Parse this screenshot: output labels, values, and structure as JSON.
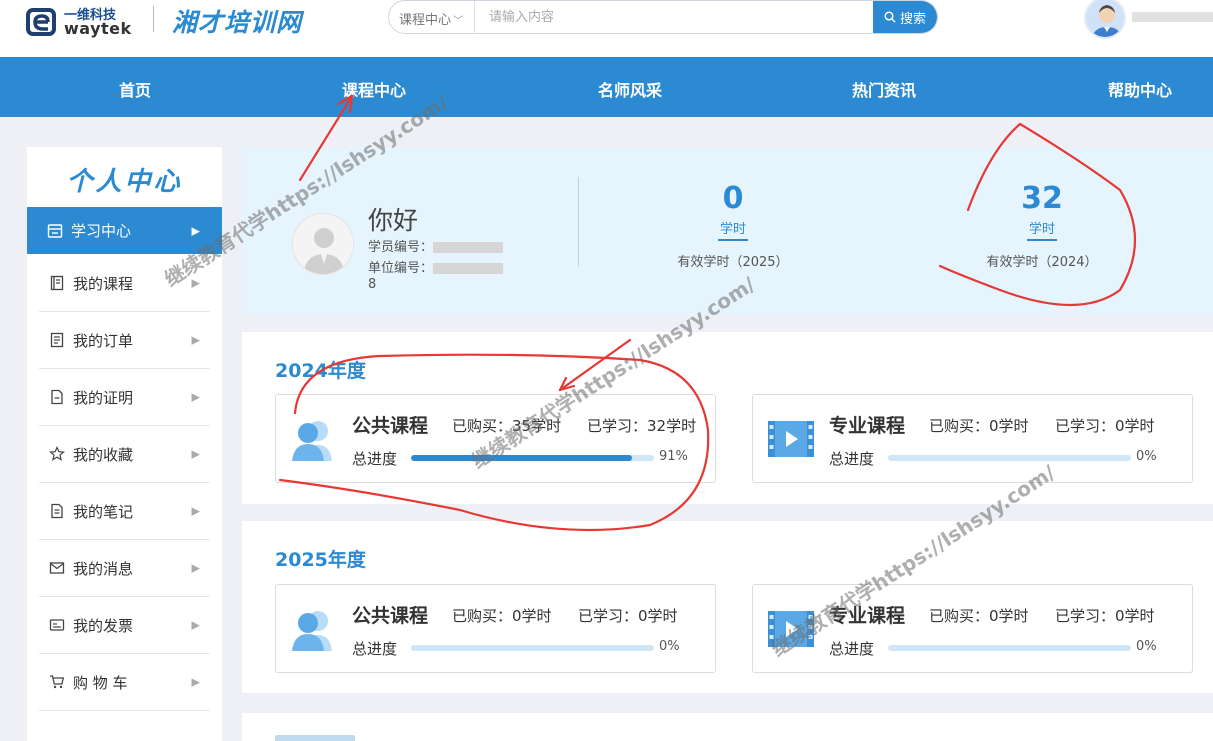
{
  "header": {
    "logo_cn": "一维科技",
    "logo_en": "waytek",
    "brand": "湘才培训网",
    "search": {
      "category": "课程中心",
      "placeholder": "请输入内容",
      "button": "搜索"
    }
  },
  "nav": {
    "items": [
      {
        "label": "首页"
      },
      {
        "label": "课程中心"
      },
      {
        "label": "名师风采"
      },
      {
        "label": "热门资讯"
      },
      {
        "label": "帮助中心"
      }
    ]
  },
  "sidebar": {
    "title": "个人中心",
    "items": [
      {
        "label": "学习中心",
        "icon": "learning-center-icon"
      },
      {
        "label": "我的课程",
        "icon": "book-icon"
      },
      {
        "label": "我的订单",
        "icon": "order-icon"
      },
      {
        "label": "我的证明",
        "icon": "certificate-icon"
      },
      {
        "label": "我的收藏",
        "icon": "star-icon"
      },
      {
        "label": "我的笔记",
        "icon": "note-icon"
      },
      {
        "label": "我的消息",
        "icon": "mail-icon"
      },
      {
        "label": "我的发票",
        "icon": "invoice-icon"
      },
      {
        "label": "购 物 车",
        "icon": "cart-icon"
      }
    ]
  },
  "welcome": {
    "greeting": "你好",
    "student_id_label": "学员编号：",
    "unit_id_label": "单位编号：",
    "unit_id_tail": "8",
    "stats": [
      {
        "value": "0",
        "unit": "学时",
        "caption": "有效学时（2025）"
      },
      {
        "value": "32",
        "unit": "学时",
        "caption": "有效学时（2024）"
      }
    ]
  },
  "years": [
    {
      "title": "2024年度",
      "courses": [
        {
          "name": "公共课程",
          "purchased": "已购买：35学时",
          "studied": "已学习：32学时",
          "progress_label": "总进度",
          "progress": 91,
          "progress_text": "91%",
          "icon": "people-icon"
        },
        {
          "name": "专业课程",
          "purchased": "已购买：0学时",
          "studied": "已学习：0学时",
          "progress_label": "总进度",
          "progress": 0,
          "progress_text": "0%",
          "icon": "video-icon"
        }
      ]
    },
    {
      "title": "2025年度",
      "courses": [
        {
          "name": "公共课程",
          "purchased": "已购买：0学时",
          "studied": "已学习：0学时",
          "progress_label": "总进度",
          "progress": 0,
          "progress_text": "0%",
          "icon": "people-icon"
        },
        {
          "name": "专业课程",
          "purchased": "已购买：0学时",
          "studied": "已学习：0学时",
          "progress_label": "总进度",
          "progress": 0,
          "progress_text": "0%",
          "icon": "video-icon"
        }
      ]
    }
  ],
  "watermark": "继续教育代学https://lshsyy.com/",
  "colors": {
    "primary": "#2b8ad1",
    "annotation": "#e53935",
    "panel": "#e6f4fd"
  }
}
